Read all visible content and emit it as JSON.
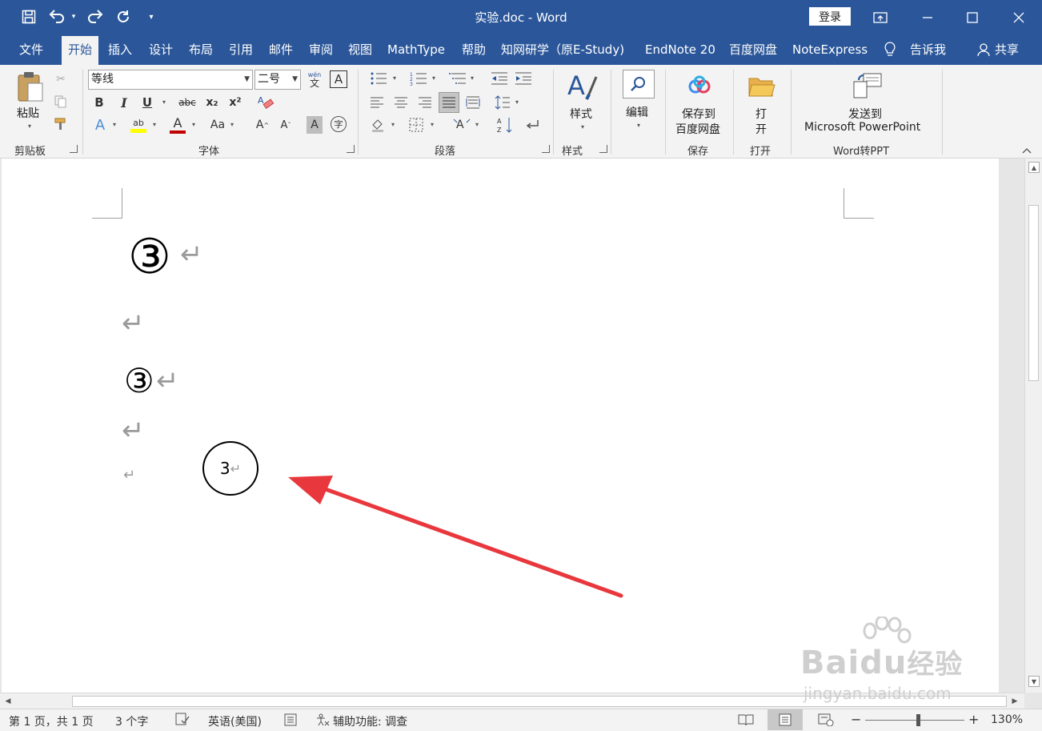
{
  "titlebar": {
    "title": "实验.doc  -  Word",
    "login_label": "登录"
  },
  "tabs": [
    {
      "label": "文件"
    },
    {
      "label": "开始",
      "active": true
    },
    {
      "label": "插入"
    },
    {
      "label": "设计"
    },
    {
      "label": "布局"
    },
    {
      "label": "引用"
    },
    {
      "label": "邮件"
    },
    {
      "label": "审阅"
    },
    {
      "label": "视图"
    },
    {
      "label": "MathType"
    },
    {
      "label": "帮助"
    },
    {
      "label": "知网研学（原E-Study)"
    },
    {
      "label": "EndNote 20"
    },
    {
      "label": "百度网盘"
    },
    {
      "label": "NoteExpress"
    },
    {
      "label": "告诉我"
    },
    {
      "label": "共享"
    }
  ],
  "ribbon": {
    "clipboard": {
      "paste_label": "粘贴",
      "group_label": "剪贴板"
    },
    "font": {
      "font_name": "等线",
      "font_size": "二号",
      "group_label": "字体",
      "text_glyphs": {
        "bold": "B",
        "italic": "I",
        "underline": "U",
        "strike": "abc",
        "sub": "x₂",
        "sup": "x²",
        "phonetic": "wén",
        "border": "A",
        "case": "Aa",
        "grow": "A",
        "shrink": "A",
        "shade": "A",
        "encircle": "字",
        "fontcolor": "A",
        "highlight": "ab"
      }
    },
    "paragraph": {
      "group_label": "段落"
    },
    "styles": {
      "button_label": "样式",
      "group_label": "样式"
    },
    "editing": {
      "button_label": "编辑"
    },
    "save": {
      "button_label_1": "保存到",
      "button_label_2": "百度网盘",
      "group_label": "保存"
    },
    "open": {
      "button_label_1": "打",
      "button_label_2": "开",
      "group_label": "打开"
    },
    "ppt": {
      "button_label_1": "发送到",
      "button_label_2": "Microsoft PowerPoint",
      "group_label": "Word转PPT"
    }
  },
  "document": {
    "circled_large": "③",
    "circled_medium": "③",
    "return_mark": "↵",
    "circle_text": "3",
    "circle_return": "↵"
  },
  "status": {
    "page": "第 1 页，共 1 页",
    "words": "3 个字",
    "language": "英语(美国)",
    "accessibility": "辅助功能: 调查",
    "zoom": "130%"
  },
  "watermark": {
    "line1": "Bai",
    "line2": "du",
    "line3": "经验",
    "url": "jingyan.baidu.com"
  },
  "colors": {
    "brand": "#2b579a",
    "ribbon_bg": "#f3f3f3",
    "arrow": "#e8383d"
  },
  "icons": [
    "save-icon",
    "undo-icon",
    "redo-icon",
    "refresh-icon",
    "customize-icon",
    "ribbon-display-icon",
    "minimize-icon",
    "maximize-icon",
    "close-icon",
    "lightbulb-icon",
    "person-icon"
  ]
}
